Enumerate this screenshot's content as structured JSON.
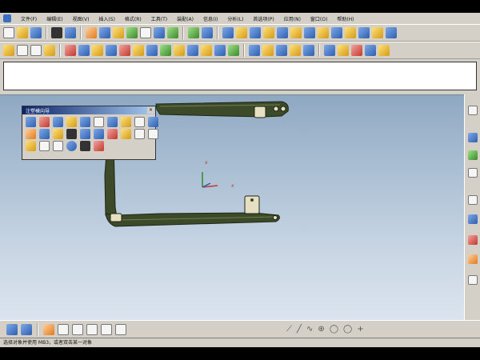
{
  "menu": {
    "items": [
      "文件(F)",
      "编辑(E)",
      "视图(V)",
      "插入(S)",
      "格式(R)",
      "工具(T)",
      "装配(A)",
      "信息(I)",
      "分析(L)",
      "首选项(P)",
      "应用(N)",
      "窗口(O)",
      "帮助(H)"
    ]
  },
  "palette": {
    "title": "注塑模向导",
    "close_label": "×"
  },
  "statusbar": {
    "text": "选择对象并使用 MB3，或者双击某一对象"
  },
  "colors": {
    "model": "#3d4a2a",
    "viewport_top": "#8fa8c2",
    "viewport_bottom": "#dbe4ee",
    "palette_title": "#0a246a"
  }
}
